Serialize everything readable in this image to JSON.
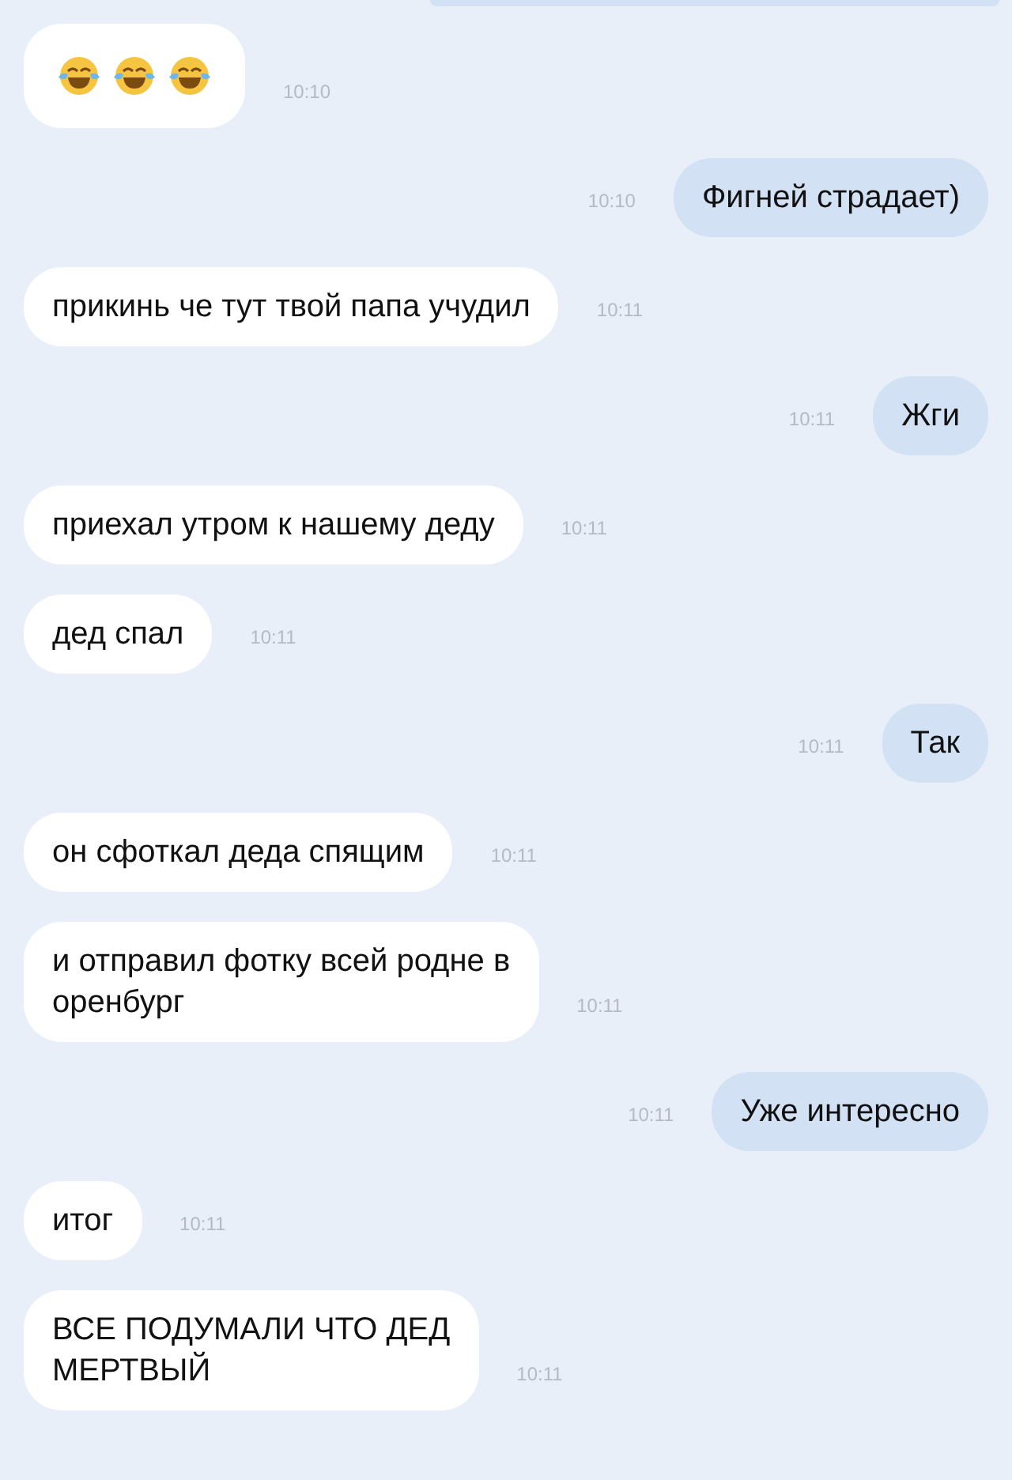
{
  "messages": [
    {
      "outgoing": false,
      "kind": "emoji",
      "emojis": [
        {
          "kind": "tears-of-joy"
        },
        {
          "kind": "tears-of-joy"
        },
        {
          "kind": "tears-of-joy"
        }
      ],
      "time": "10:10"
    },
    {
      "outgoing": true,
      "kind": "text",
      "text": "Фигней страдает)",
      "time": "10:10"
    },
    {
      "outgoing": false,
      "kind": "text",
      "text": "прикинь че тут твой папа учудил",
      "time": "10:11"
    },
    {
      "outgoing": true,
      "kind": "text",
      "text": "Жги",
      "time": "10:11"
    },
    {
      "outgoing": false,
      "kind": "text",
      "text": "приехал утром к нашему деду",
      "time": "10:11"
    },
    {
      "outgoing": false,
      "kind": "text",
      "text": "дед спал",
      "time": "10:11"
    },
    {
      "outgoing": true,
      "kind": "text",
      "text": "Так",
      "time": "10:11"
    },
    {
      "outgoing": false,
      "kind": "text",
      "text": "он сфоткал деда спящим",
      "time": "10:11"
    },
    {
      "outgoing": false,
      "kind": "text",
      "text": "и отправил фотку всей родне в\nоренбург",
      "time": "10:11"
    },
    {
      "outgoing": true,
      "kind": "text",
      "text": "Уже интересно",
      "time": "10:11"
    },
    {
      "outgoing": false,
      "kind": "text",
      "text": "итог",
      "time": "10:11"
    },
    {
      "outgoing": false,
      "kind": "text",
      "text": "ВСЕ ПОДУМАЛИ ЧТО ДЕД\nМЕРТВЫЙ",
      "time": "10:11"
    }
  ]
}
